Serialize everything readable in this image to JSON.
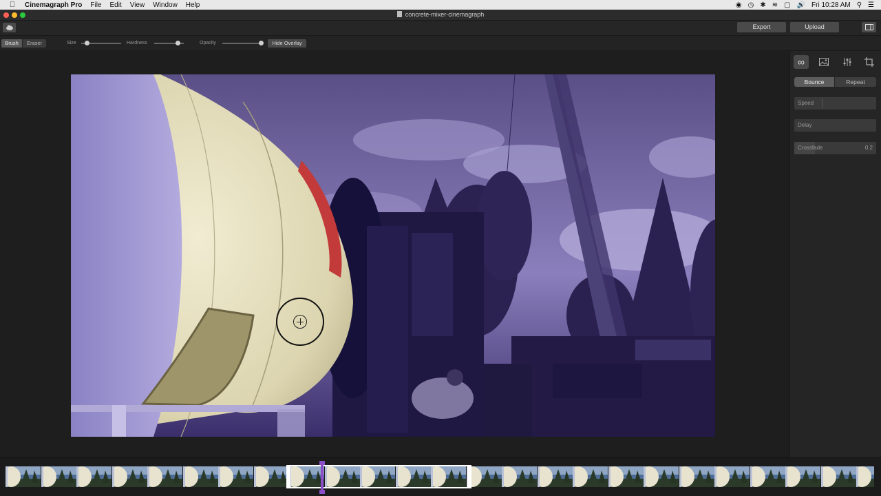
{
  "menubar": {
    "app_name": "Cinemagraph Pro",
    "menus": [
      "File",
      "Edit",
      "View",
      "Window",
      "Help"
    ],
    "clock": "Fri 10:28 AM"
  },
  "window": {
    "title": "concrete-mixer-cinemagraph"
  },
  "toolbar": {
    "export_label": "Export",
    "upload_label": "Upload"
  },
  "brush_options": {
    "modes": [
      "Brush",
      "Eraser"
    ],
    "active_mode": "Brush",
    "size_label": "Size",
    "size_value": 0.15,
    "hardness_label": "Hardness",
    "hardness_value": 0.8,
    "opacity_label": "Opacity",
    "opacity_value": 1.0,
    "hide_overlay_label": "Hide Overlay"
  },
  "side_panel": {
    "tabs": [
      "loop-icon",
      "image-icon",
      "adjustments-icon",
      "crop-icon"
    ],
    "loop_modes": [
      "Bounce",
      "Repeat"
    ],
    "active_loop_mode": "Bounce",
    "speed_label": "Speed",
    "delay_label": "Delay",
    "crossfade_label": "Crossfade",
    "crossfade_value": "0.2"
  },
  "colors": {
    "mask_overlay": "#3b2f7a",
    "accent_purple": "#8a4fc8",
    "button_bg": "#4a4a4a"
  }
}
